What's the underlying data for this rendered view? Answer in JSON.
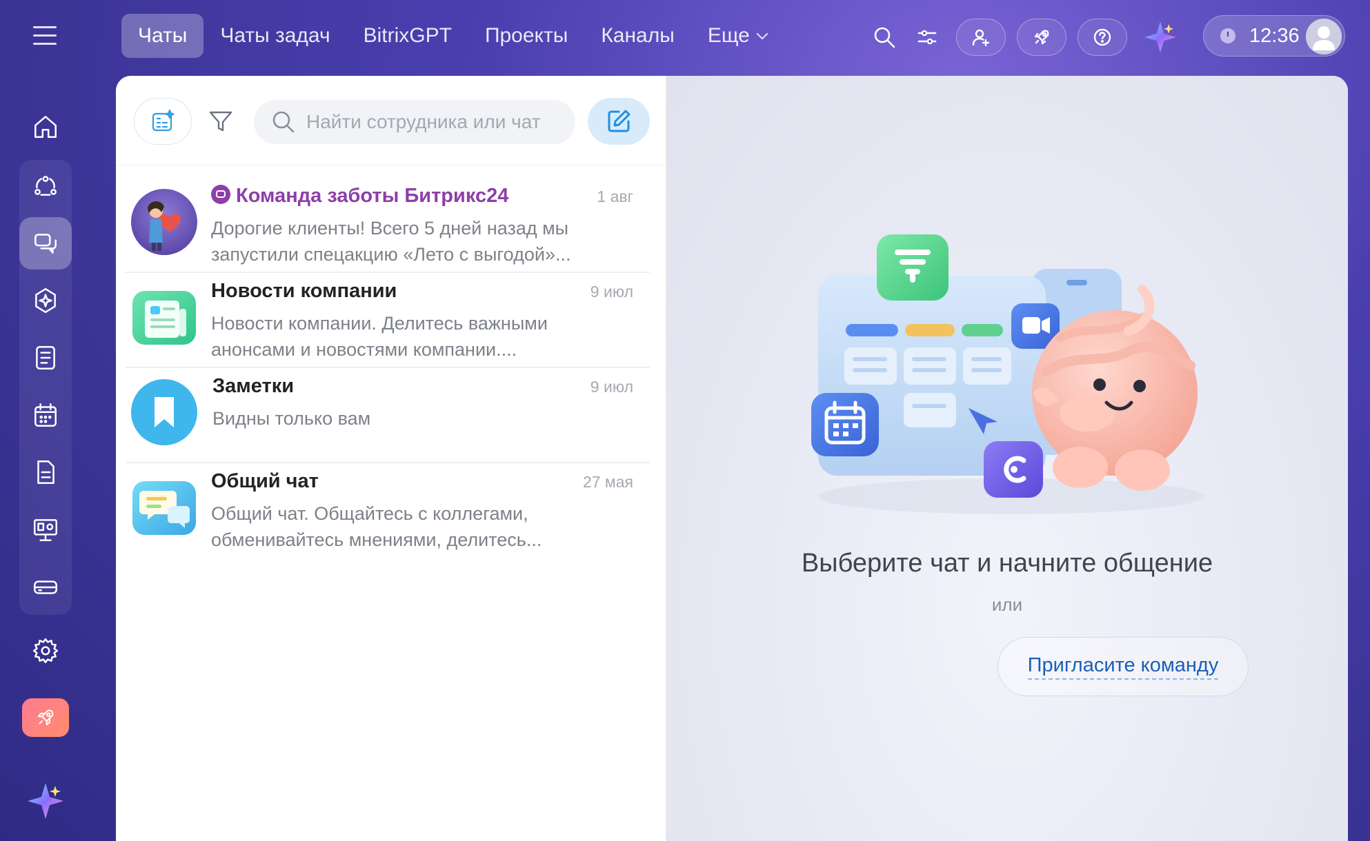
{
  "nav": {
    "tabs": [
      {
        "label": "Чаты",
        "active": true
      },
      {
        "label": "Чаты задач",
        "active": false
      },
      {
        "label": "BitrixGPT",
        "active": false
      },
      {
        "label": "Проекты",
        "active": false
      },
      {
        "label": "Каналы",
        "active": false
      },
      {
        "label": "Еще",
        "active": false
      }
    ],
    "time": "12:36"
  },
  "sidebar": {
    "items": [
      {
        "name": "home-icon",
        "active": false
      },
      {
        "name": "feed-icon",
        "active": false
      },
      {
        "name": "chats-icon",
        "active": true
      },
      {
        "name": "copilot-icon",
        "active": false
      },
      {
        "name": "tasks-icon",
        "active": false
      },
      {
        "name": "calendar-icon",
        "active": false
      },
      {
        "name": "docs-icon",
        "active": false
      },
      {
        "name": "board-icon",
        "active": false
      },
      {
        "name": "drive-icon",
        "active": false
      },
      {
        "name": "settings-icon",
        "active": false
      }
    ]
  },
  "search": {
    "placeholder": "Найти сотрудника или чат"
  },
  "chats": [
    {
      "title": "Команда заботы Битрикс24",
      "date": "1 авг",
      "message": "Дорогие клиенты! Всего 5 дней назад мы запустили спецакцию «Лето с выгодой»...",
      "avatar": "support-avatar"
    },
    {
      "title": "Новости компании",
      "date": "9 июл",
      "message": "Новости компании. Делитесь важными анонсами и новостями компании....",
      "avatar": "news-avatar"
    },
    {
      "title": "Заметки",
      "date": "9 июл",
      "message": "Видны только вам",
      "avatar": "bookmark-avatar"
    },
    {
      "title": "Общий чат",
      "date": "27 мая",
      "message": "Общий чат. Общайтесь с коллегами, обменивайтесь мнениями, делитесь...",
      "avatar": "chat-avatar"
    }
  ],
  "empty_state": {
    "title": "Выберите чат и начните общение",
    "or": "или",
    "invite": "Пригласите команду"
  },
  "colors": {
    "accent": "#1f8ee0",
    "support_title": "#8e3fa7",
    "link": "#1b5fb5"
  }
}
